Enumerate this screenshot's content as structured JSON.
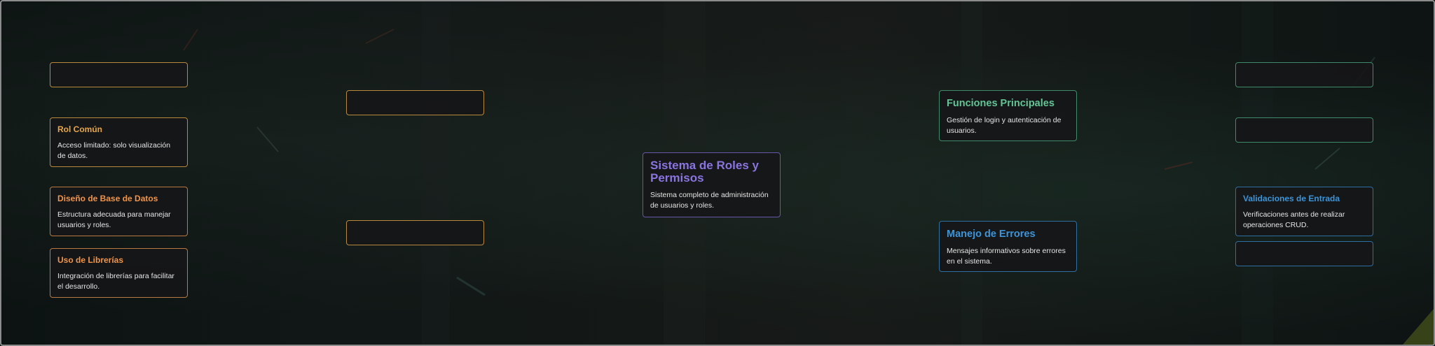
{
  "central": {
    "title": "Sistema de Roles y Permisos",
    "description": "Sistema completo de administración de usuarios y roles."
  },
  "left_branch": {
    "rol_comun": {
      "title": "Rol Común",
      "description": "Acceso limitado: solo visualización de datos."
    },
    "base_datos": {
      "title": "Diseño de Base de Datos",
      "description": "Estructura adecuada para manejar usuarios y roles."
    },
    "librerias": {
      "title": "Uso de Librerías",
      "description": "Integración de librerías para facilitar el desarrollo."
    }
  },
  "right_branch": {
    "funciones": {
      "title": "Funciones Principales",
      "description": "Gestión de login y autenticación de usuarios."
    },
    "errores": {
      "title": "Manejo de Errores",
      "description": "Mensajes informativos sobre errores en el sistema."
    },
    "validaciones": {
      "title": "Validaciones de Entrada",
      "description": "Verificaciones antes de realizar operaciones CRUD."
    }
  },
  "colors": {
    "gold": "#b8893d",
    "orange": "#f0944a",
    "green": "#63c596",
    "blue": "#3d94d8",
    "purple": "#8a74e0"
  }
}
